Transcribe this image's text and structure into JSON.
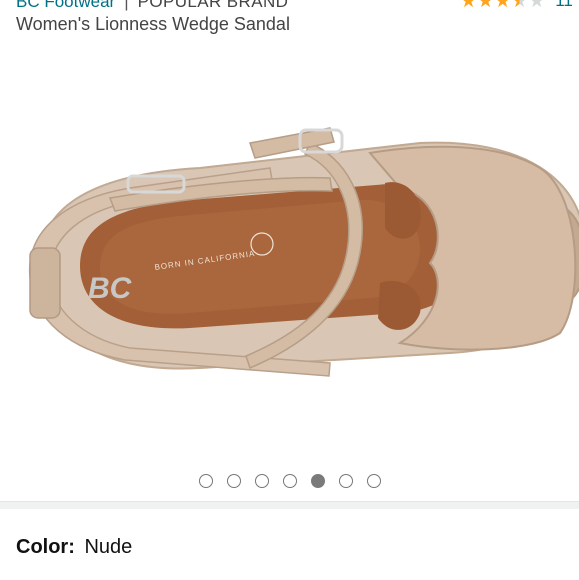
{
  "header": {
    "brand": "BC Footwear",
    "separator": "|",
    "badge": "POPULAR BRAND",
    "rating_value": 3.5,
    "rating_count": "11",
    "product_title": "Women's Lionness Wedge Sandal"
  },
  "image": {
    "name": "wedge sandal product photo",
    "insole_logo": "BC",
    "insole_text": "BORN IN CALIFORNIA"
  },
  "carousel": {
    "total": 7,
    "active_index": 4
  },
  "selection": {
    "color_label": "Color:",
    "color_value": "Nude"
  },
  "colors": {
    "link": "#007185",
    "star": "#ffa41c",
    "sandal": "#d7c1ad",
    "insole": "#a0603a"
  }
}
